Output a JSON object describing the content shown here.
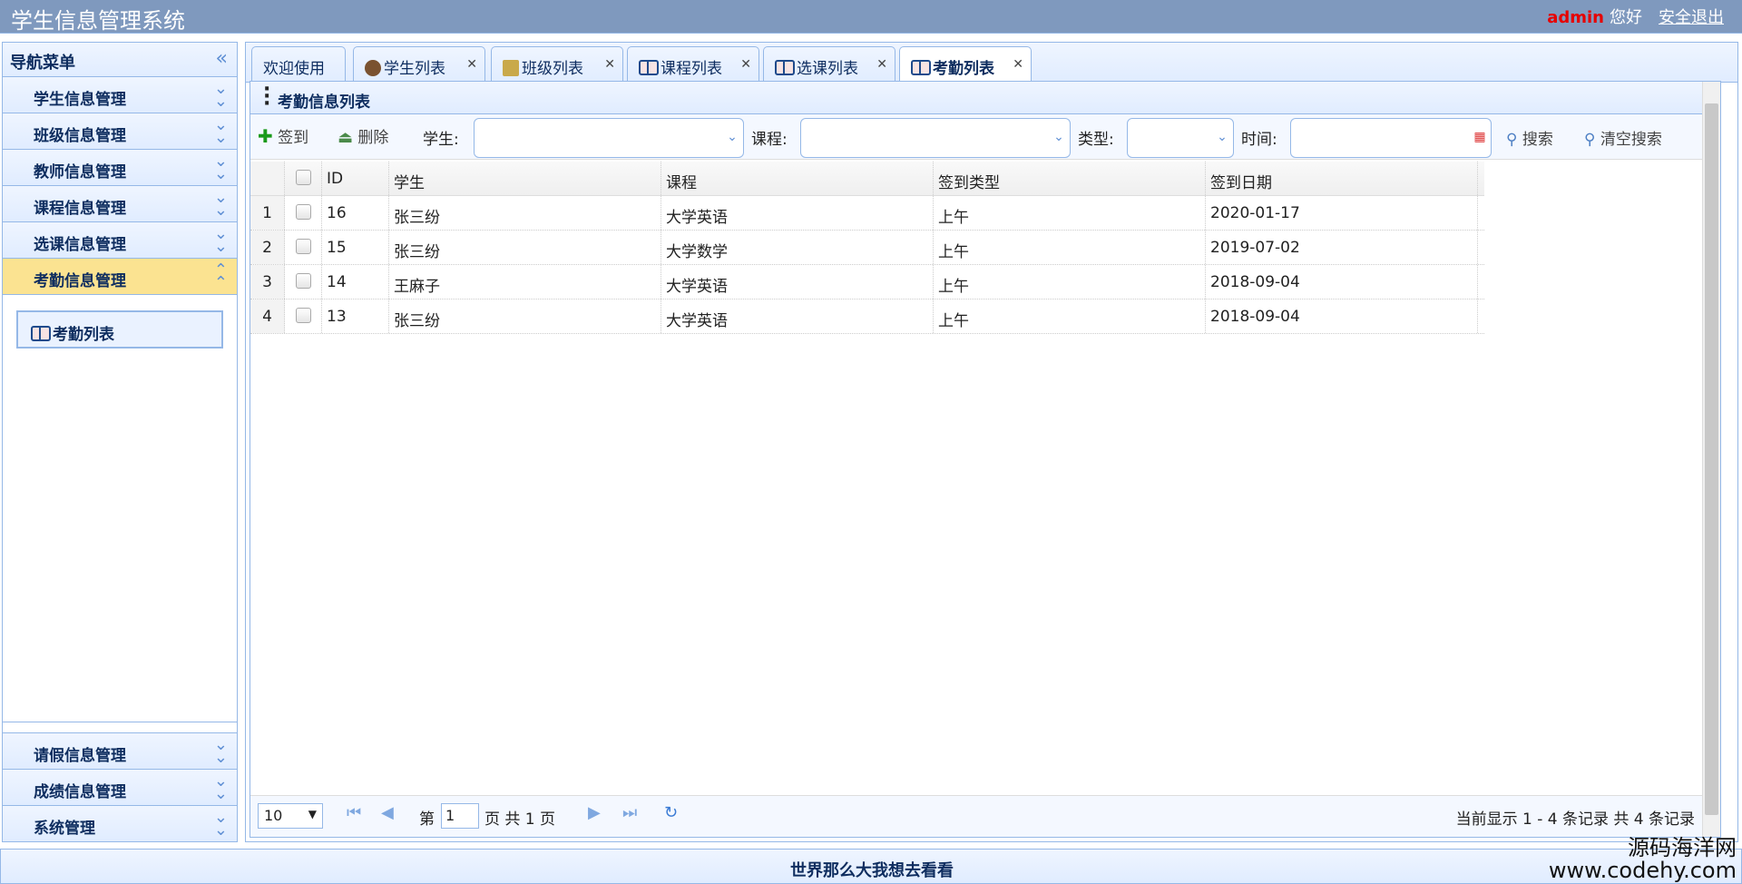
{
  "header": {
    "title": "学生信息管理系统",
    "user": "admin",
    "greeting": "您好",
    "logout": "安全退出"
  },
  "nav": {
    "title": "导航菜单",
    "items": [
      {
        "label": "学生信息管理"
      },
      {
        "label": "班级信息管理"
      },
      {
        "label": "教师信息管理"
      },
      {
        "label": "课程信息管理"
      },
      {
        "label": "选课信息管理"
      },
      {
        "label": "考勤信息管理"
      }
    ],
    "sublink": "考勤列表",
    "bottom": [
      {
        "label": "请假信息管理"
      },
      {
        "label": "成绩信息管理"
      },
      {
        "label": "系统管理"
      }
    ]
  },
  "tabs": [
    {
      "label": "欢迎使用"
    },
    {
      "label": "学生列表"
    },
    {
      "label": "班级列表"
    },
    {
      "label": "课程列表"
    },
    {
      "label": "选课列表"
    },
    {
      "label": "考勤列表"
    }
  ],
  "panel": {
    "title": "考勤信息列表"
  },
  "toolbar": {
    "signin": "签到",
    "delete": "删除",
    "student_label": "学生:",
    "course_label": "课程:",
    "type_label": "类型:",
    "time_label": "时间:",
    "search": "搜索",
    "clear": "清空搜索"
  },
  "grid": {
    "columns": [
      "ID",
      "学生",
      "课程",
      "签到类型",
      "签到日期"
    ],
    "rows": [
      {
        "n": "1",
        "id": "16",
        "student": "张三纷",
        "course": "大学英语",
        "type": "上午",
        "date": "2020-01-17"
      },
      {
        "n": "2",
        "id": "15",
        "student": "张三纷",
        "course": "大学数学",
        "type": "上午",
        "date": "2019-07-02"
      },
      {
        "n": "3",
        "id": "14",
        "student": "王麻子",
        "course": "大学英语",
        "type": "上午",
        "date": "2018-09-04"
      },
      {
        "n": "4",
        "id": "13",
        "student": "张三纷",
        "course": "大学英语",
        "type": "上午",
        "date": "2018-09-04"
      }
    ]
  },
  "pager": {
    "page_size": "10",
    "page_prefix": "第",
    "page": "1",
    "page_suffix": "页 共 1 页",
    "summary": "当前显示 1 - 4 条记录 共 4 条记录"
  },
  "footer": {
    "text": "世界那么大我想去看看"
  },
  "watermark": {
    "line1": "源码海洋网",
    "line2": "www.codehy.com"
  },
  "colors": {
    "header": "#7f99be",
    "selected": "#fbe391",
    "border": "#95b8e7"
  }
}
